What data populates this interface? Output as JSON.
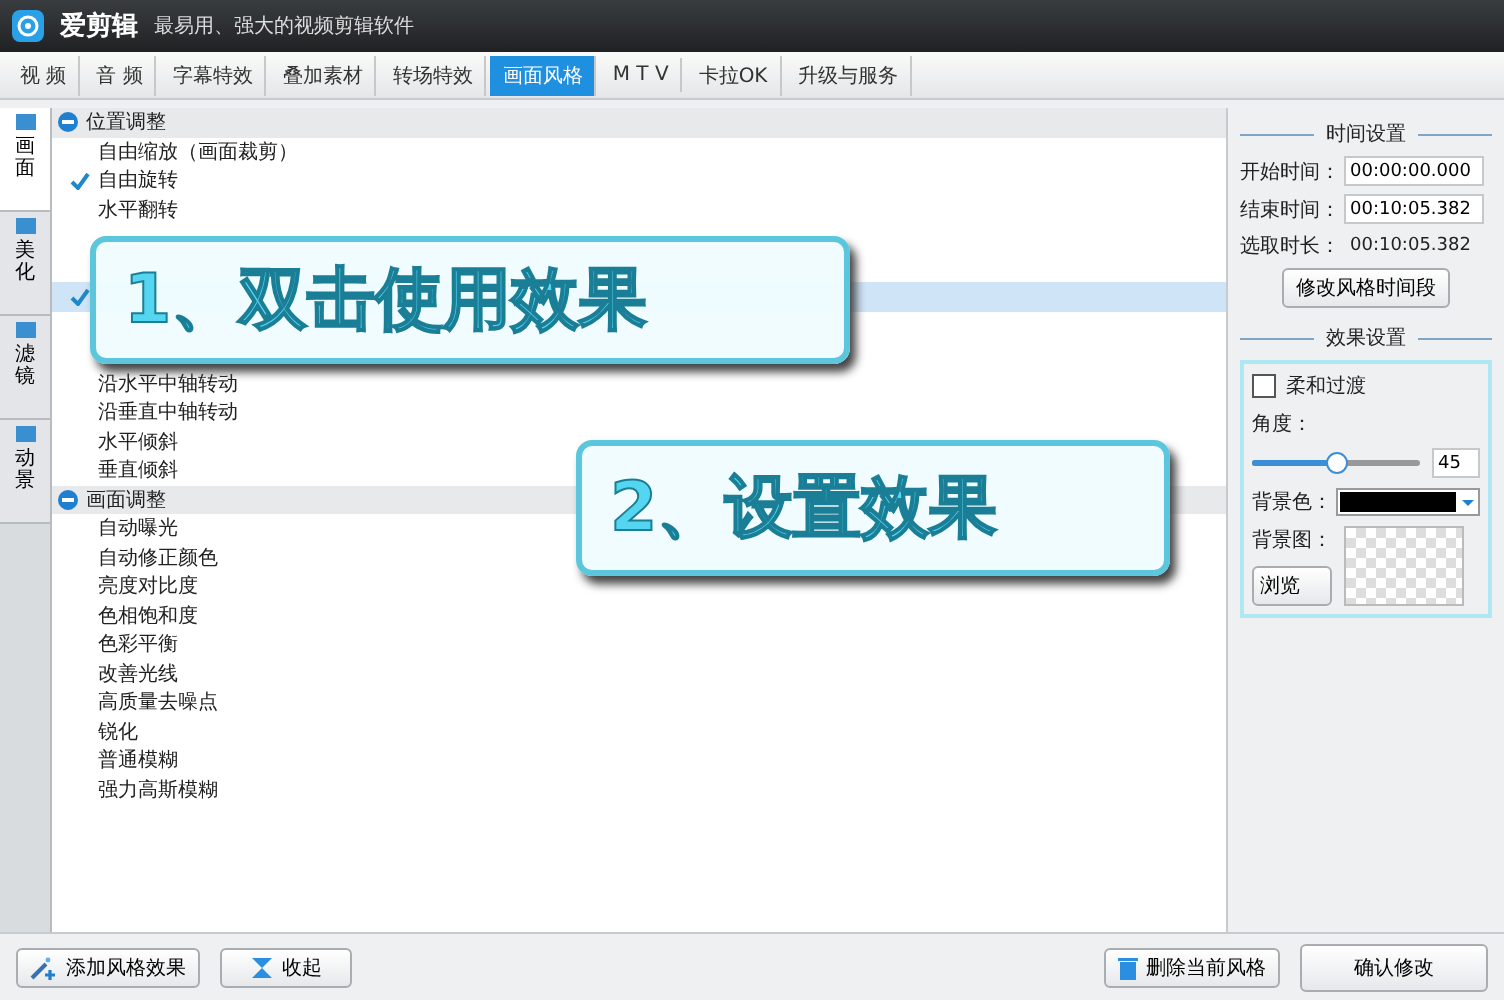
{
  "window": {
    "app_name": "爱剪辑",
    "tagline": "最易用、强大的视频剪辑软件"
  },
  "tabs": [
    {
      "label": "视 频",
      "selected": false
    },
    {
      "label": "音 频",
      "selected": false
    },
    {
      "label": "字幕特效",
      "selected": false
    },
    {
      "label": "叠加素材",
      "selected": false
    },
    {
      "label": "转场特效",
      "selected": false
    },
    {
      "label": "画面风格",
      "selected": true
    },
    {
      "label": "M T V",
      "selected": false
    },
    {
      "label": "卡拉OK",
      "selected": false
    },
    {
      "label": "升级与服务",
      "selected": false
    }
  ],
  "side_tabs": [
    {
      "label": "画面",
      "selected": true
    },
    {
      "label": "美化",
      "selected": false
    },
    {
      "label": "滤镜",
      "selected": false
    },
    {
      "label": "动景",
      "selected": false
    }
  ],
  "tree": [
    {
      "label": "位置调整",
      "expanded": true,
      "items": [
        {
          "kind": "option",
          "label": "自由缩放（画面裁剪）",
          "checked": false,
          "selected": false
        },
        {
          "kind": "option",
          "label": "自由旋转",
          "checked": true,
          "selected": false
        },
        {
          "kind": "option",
          "label": "水平翻转",
          "checked": false,
          "selected": false
        },
        {
          "kind": "covered",
          "checked": false,
          "selected": false
        },
        {
          "kind": "covered",
          "checked": false,
          "selected": false
        },
        {
          "kind": "covered",
          "checked": true,
          "selected": true
        },
        {
          "kind": "covered",
          "checked": false,
          "selected": false
        },
        {
          "kind": "covered",
          "checked": false,
          "selected": false
        },
        {
          "kind": "option",
          "label": "沿水平中轴转动",
          "checked": false,
          "selected": false
        },
        {
          "kind": "option",
          "label": "沿垂直中轴转动",
          "checked": false,
          "selected": false
        },
        {
          "kind": "option",
          "label": "水平倾斜",
          "checked": false,
          "selected": false
        },
        {
          "kind": "option",
          "label": "垂直倾斜",
          "checked": false,
          "selected": false
        }
      ]
    },
    {
      "label": "画面调整",
      "expanded": true,
      "items": [
        {
          "kind": "option",
          "label": "自动曝光",
          "checked": false,
          "selected": false
        },
        {
          "kind": "option",
          "label": "自动修正颜色",
          "checked": false,
          "selected": false
        },
        {
          "kind": "option",
          "label": "亮度对比度",
          "checked": false,
          "selected": false
        },
        {
          "kind": "option",
          "label": "色相饱和度",
          "checked": false,
          "selected": false
        },
        {
          "kind": "option",
          "label": "色彩平衡",
          "checked": false,
          "selected": false
        },
        {
          "kind": "option",
          "label": "改善光线",
          "checked": false,
          "selected": false
        },
        {
          "kind": "option",
          "label": "高质量去噪点",
          "checked": false,
          "selected": false
        },
        {
          "kind": "option",
          "label": "锐化",
          "checked": false,
          "selected": false
        },
        {
          "kind": "option",
          "label": "普通模糊",
          "checked": false,
          "selected": false
        },
        {
          "kind": "option",
          "label": "强力高斯模糊",
          "checked": false,
          "selected": false
        }
      ]
    }
  ],
  "callouts": [
    {
      "text": "1、双击使用效果"
    },
    {
      "text": "2、设置效果"
    }
  ],
  "time_settings": {
    "title": "时间设置",
    "fields": [
      {
        "kind": "input",
        "label": "开始时间：",
        "value": "00:00:00.000"
      },
      {
        "kind": "input",
        "label": "结束时间：",
        "value": "00:10:05.382"
      },
      {
        "kind": "plain",
        "label": "选取时长：",
        "value": "00:10:05.382"
      }
    ],
    "button": "修改风格时间段"
  },
  "effect_settings": {
    "title": "效果设置",
    "soft_transition": {
      "label": "柔和过渡",
      "checked": false
    },
    "angle": {
      "label": "角度：",
      "level": 0.5,
      "value": "45"
    },
    "bg_color": {
      "label": "背景色：",
      "color": "#000000"
    },
    "bg_image": {
      "label": "背景图：",
      "button": "浏览"
    }
  },
  "bottom_buttons": {
    "add": "添加风格效果",
    "collapse": "收起",
    "delete": "删除当前风格",
    "confirm": "确认修改"
  }
}
